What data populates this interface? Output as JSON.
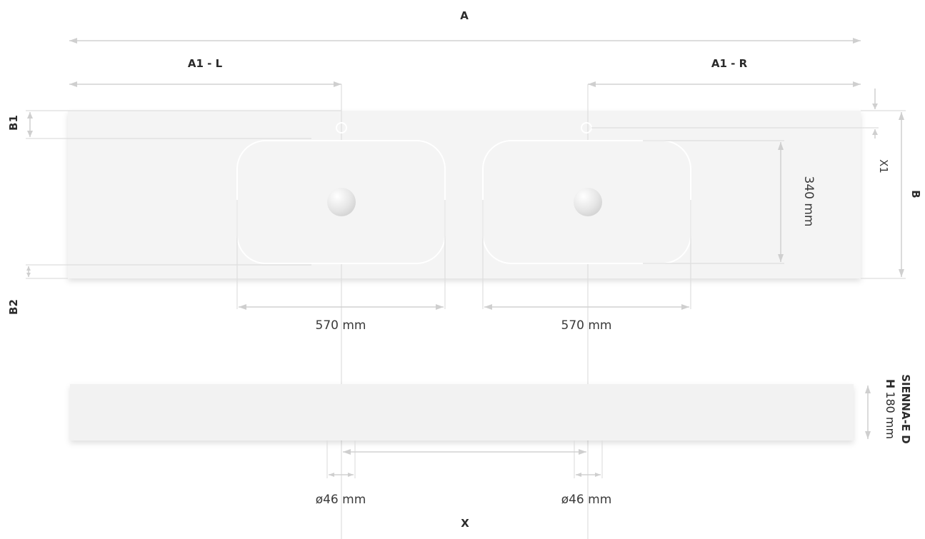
{
  "dimensions": {
    "A": "A",
    "A1_left": "A1 - L",
    "A1_right": "A1 - R",
    "B": "B",
    "B1": "B1",
    "B2": "B2",
    "X1": "X1",
    "X": "X"
  },
  "basins": {
    "left_width": "570 mm",
    "right_width": "570 mm",
    "depth": "340 mm"
  },
  "drains": {
    "left_diameter": "ø46 mm",
    "right_diameter": "ø46 mm"
  },
  "side_view": {
    "model": "SIENNA-E D",
    "height_prefix": "H",
    "height_value": "180 mm"
  }
}
